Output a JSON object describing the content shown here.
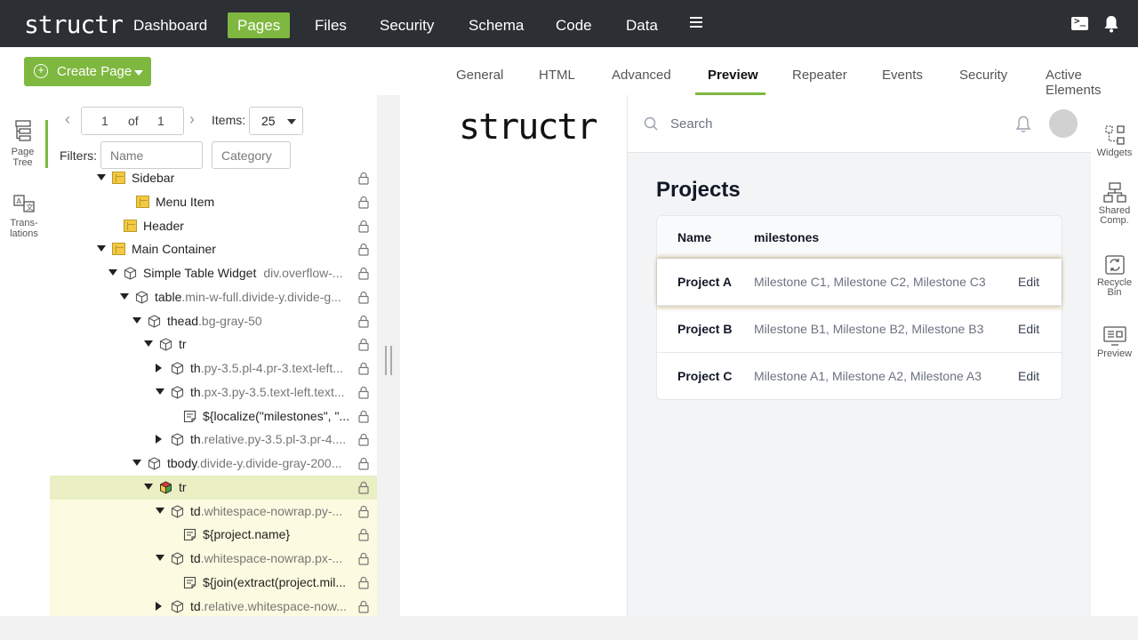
{
  "topnav": {
    "logo": "structr",
    "items": [
      "Dashboard",
      "Pages",
      "Files",
      "Security",
      "Schema",
      "Code",
      "Data"
    ],
    "active": "Pages",
    "icons": [
      "menu-icon",
      "terminal-icon",
      "bell-icon"
    ]
  },
  "toolbar": {
    "create_label": "Create Page",
    "tabs": [
      "General",
      "HTML",
      "Advanced",
      "Preview",
      "Repeater",
      "Events",
      "Security",
      "Active Elements"
    ],
    "active_tab": "Preview"
  },
  "leftrail": {
    "items": [
      {
        "label": "Page Tree",
        "line1": "Page",
        "line2": "Tree"
      },
      {
        "label": "Translations",
        "line1": "Trans-",
        "line2": "lations"
      }
    ]
  },
  "pager": {
    "page": "1",
    "of_label": "of",
    "total": "1",
    "items_label": "Items:",
    "items_value": "25",
    "filters_label": "Filters:",
    "name_placeholder": "Name",
    "category_placeholder": "Category"
  },
  "tree": [
    {
      "tag": "Sidebar",
      "cls": ""
    },
    {
      "tag": "Menu Item",
      "cls": ""
    },
    {
      "tag": "Header",
      "cls": ""
    },
    {
      "tag": "Main Container",
      "cls": ""
    },
    {
      "tag": "Simple Table Widget",
      "cls": "div.overflow-..."
    },
    {
      "tag": "table",
      "cls": ".min-w-full.divide-y.divide-g..."
    },
    {
      "tag": "thead",
      "cls": ".bg-gray-50"
    },
    {
      "tag": "tr",
      "cls": ""
    },
    {
      "tag": "th",
      "cls": ".py-3.5.pl-4.pr-3.text-left..."
    },
    {
      "tag": "th",
      "cls": ".px-3.py-3.5.text-left.text..."
    },
    {
      "tag": "${localize(\"milestones\", \"...",
      "cls": ""
    },
    {
      "tag": "th",
      "cls": ".relative.py-3.5.pl-3.pr-4...."
    },
    {
      "tag": "tbody",
      "cls": ".divide-y.divide-gray-200..."
    },
    {
      "tag": "tr",
      "cls": ""
    },
    {
      "tag": "td",
      "cls": ".whitespace-nowrap.py-..."
    },
    {
      "tag": "${project.name}",
      "cls": ""
    },
    {
      "tag": "td",
      "cls": ".whitespace-nowrap.px-..."
    },
    {
      "tag": "${join(extract(project.mil...",
      "cls": ""
    },
    {
      "tag": "td",
      "cls": ".relative.whitespace-now..."
    }
  ],
  "preview": {
    "logo": "structr",
    "search_placeholder": "Search",
    "title": "Projects",
    "columns": [
      "Name",
      "milestones"
    ],
    "rows": [
      {
        "name": "Project A",
        "milestones": "Milestone C1, Milestone C2, Milestone C3",
        "action": "Edit"
      },
      {
        "name": "Project B",
        "milestones": "Milestone B1, Milestone B2, Milestone B3",
        "action": "Edit"
      },
      {
        "name": "Project C",
        "milestones": "Milestone A1, Milestone A2, Milestone A3",
        "action": "Edit"
      }
    ]
  },
  "rightrail": {
    "items": [
      {
        "line1": "Widgets",
        "line2": ""
      },
      {
        "line1": "Shared",
        "line2": "Comp."
      },
      {
        "line1": "Recycle",
        "line2": "Bin"
      },
      {
        "line1": "Preview",
        "line2": ""
      }
    ]
  },
  "colors": {
    "accent": "#7fb840",
    "nav_bg": "#2c2f33",
    "selected_row": "#eaefc4",
    "highlight_row": "#fcfbe1"
  }
}
